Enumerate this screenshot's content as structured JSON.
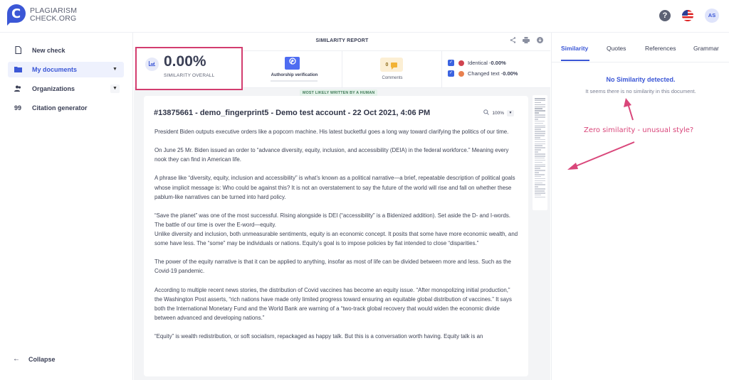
{
  "header": {
    "logo_line1": "PLAGIARISM",
    "logo_line2": "CHECK.ORG",
    "logo_glyph": "C",
    "help_icon": "?",
    "avatar_initials": "AS"
  },
  "sidebar": {
    "items": [
      {
        "label": "New check",
        "icon": "file-icon",
        "glyph": "🗋"
      },
      {
        "label": "My documents",
        "icon": "folder-icon",
        "glyph": "▬",
        "active": true,
        "caret": "▼"
      },
      {
        "label": "Organizations",
        "icon": "users-icon",
        "glyph": "👥",
        "caret": "▼"
      },
      {
        "label": "Citation generator",
        "icon": "quote-icon",
        "glyph": "99"
      }
    ],
    "collapse_label": "Collapse",
    "collapse_glyph": "←"
  },
  "report": {
    "title": "SIMILARITY REPORT",
    "actions": {
      "share": "<",
      "print": "⎙",
      "download": "⬇"
    },
    "similarity_value": "0.00%",
    "similarity_label": "SIMILARITY OVERALL",
    "authorship_label": "Authorship verification",
    "comments_count": "0",
    "comments_label": "Comments",
    "legend": [
      {
        "label": "Identical - ",
        "value": "0.00%",
        "color": "#d0434f",
        "checked": true
      },
      {
        "label": "Changed text - ",
        "value": "0.00%",
        "color": "#e8804f",
        "checked": true
      }
    ],
    "human_badge": "MOST LIKELY WRITTEN BY A HUMAN"
  },
  "document": {
    "title": "#13875661 - demo_fingerprint5 - Demo test account - 22 Oct 2021, 4:06 PM",
    "zoom": "100%",
    "paragraphs": [
      "President Biden outputs executive orders like a popcorn machine. His latest bucketful goes a long way toward clarifying the politics of our time.",
      "On June 25 Mr. Biden issued an order to “advance diversity, equity, inclusion, and accessibility (DEIA) in the federal workforce.” Meaning every nook they can find in American life.",
      "A phrase like “diversity, equity, inclusion and accessibility” is what’s known as a political narrative—a brief, repeatable description of political goals whose implicit message is: Who could be against this? It is not an overstatement to say the future of the world will rise and fall on whether these pablum-like narratives can be turned into hard policy.",
      "“Save the planet” was one of the most successful. Rising alongside is DEI (“accessibility” is a Bidenized addition). Set aside the D- and I-words. The battle of our time is over the E-word—equity.",
      "Unlike diversity and inclusion, both unmeasurable sentiments, equity is an economic concept. It posits that some have more economic wealth, and some have less. The “some” may be individuals or nations. Equity’s goal is to impose policies by fiat intended to close “disparities.”",
      "The power of the equity narrative is that it can be applied to anything, insofar as most of life can be divided between more and less. Such as the Covid-19 pandemic.",
      "According to multiple recent news stories, the distribution of Covid vaccines has become an equity issue. “After monopolizing initial production,” the Washington Post asserts, “rich nations have made only limited progress toward ensuring an equitable global distribution of vaccines.” It says both the International Monetary Fund and the World Bank are warning of a “two-track global recovery that would widen the economic divide between advanced and developing nations.”",
      "“Equity” is wealth redistribution, or soft socialism, repackaged as happy talk. But this is a conversation worth having. Equity talk is an"
    ]
  },
  "right_panel": {
    "tabs": [
      "Similarity",
      "Quotes",
      "References",
      "Grammar"
    ],
    "active_tab": "Similarity",
    "empty_title": "No Similarity detected.",
    "empty_subtitle": "It seems there is no similarity in this document."
  },
  "annotation": {
    "text": "Zero similarity - unusual style?",
    "color": "#d9467a"
  }
}
